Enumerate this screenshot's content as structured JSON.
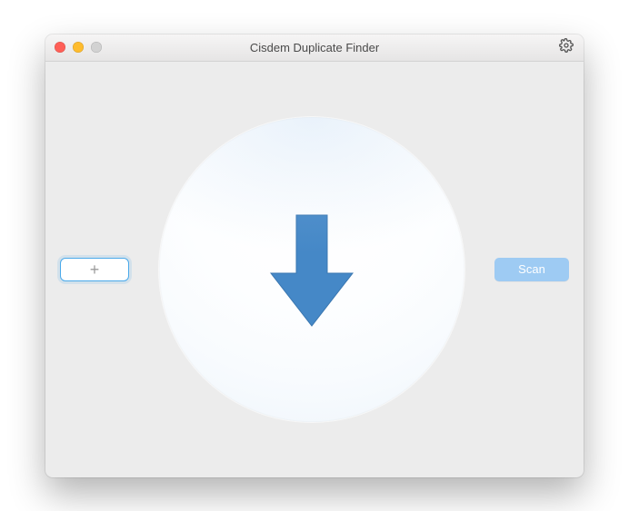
{
  "window": {
    "title": "Cisdem Duplicate Finder"
  },
  "traffic_lights": {
    "close_name": "close",
    "minimize_name": "minimize",
    "zoom_name": "zoom"
  },
  "toolbar": {
    "settings_name": "settings"
  },
  "content": {
    "add_label": "+",
    "scan_label": "Scan",
    "drop_hint": "drop-target"
  },
  "colors": {
    "accent_blue": "#4588c7",
    "scan_blue": "#9ecbf3"
  }
}
